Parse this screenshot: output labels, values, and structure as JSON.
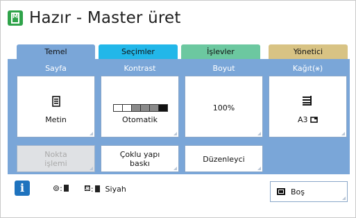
{
  "header": {
    "title": "Hazır - Master üret",
    "icon": "master-app-icon",
    "icon_letter": "M"
  },
  "tabs": [
    {
      "label": "Temel",
      "color": "#7aa6d8"
    },
    {
      "label": "Seçimler",
      "color": "#22b7e9"
    },
    {
      "label": "İşlevler",
      "color": "#6cc8a0"
    },
    {
      "label": "Yönetici",
      "color": "#d8c384"
    }
  ],
  "columns": {
    "sayfa": {
      "label": "Sayfa",
      "value": "Metin",
      "icon": "document-icon"
    },
    "kontrast": {
      "label": "Kontrast",
      "value": "Otomatik",
      "icon": "contrast-bar-icon"
    },
    "boyut": {
      "label": "Boyut",
      "value": "100%"
    },
    "kagit": {
      "label": "Kağıt(⚹)",
      "value": "A3",
      "icon": "paper-stack-icon"
    }
  },
  "functions": [
    {
      "label_line1": "Nokta",
      "label_line2": "işlemi",
      "enabled": false
    },
    {
      "label_line1": "Çoklu yapı",
      "label_line2": "baskı",
      "enabled": true
    },
    {
      "label_line1": "Düzenleyci",
      "label_line2": "",
      "enabled": true
    }
  ],
  "status": {
    "info_label": "i",
    "master_symbol": "⊚",
    "master_sep": ":",
    "ink_symbol": "⛾",
    "ink_sep": ":",
    "ink_color": "Siyah"
  },
  "mode_button": {
    "label": "Boş",
    "icon": "monitor-icon"
  },
  "colors": {
    "panel": "#7aa6d8",
    "accent_green": "#2fa34a",
    "info_blue": "#1e73be"
  }
}
